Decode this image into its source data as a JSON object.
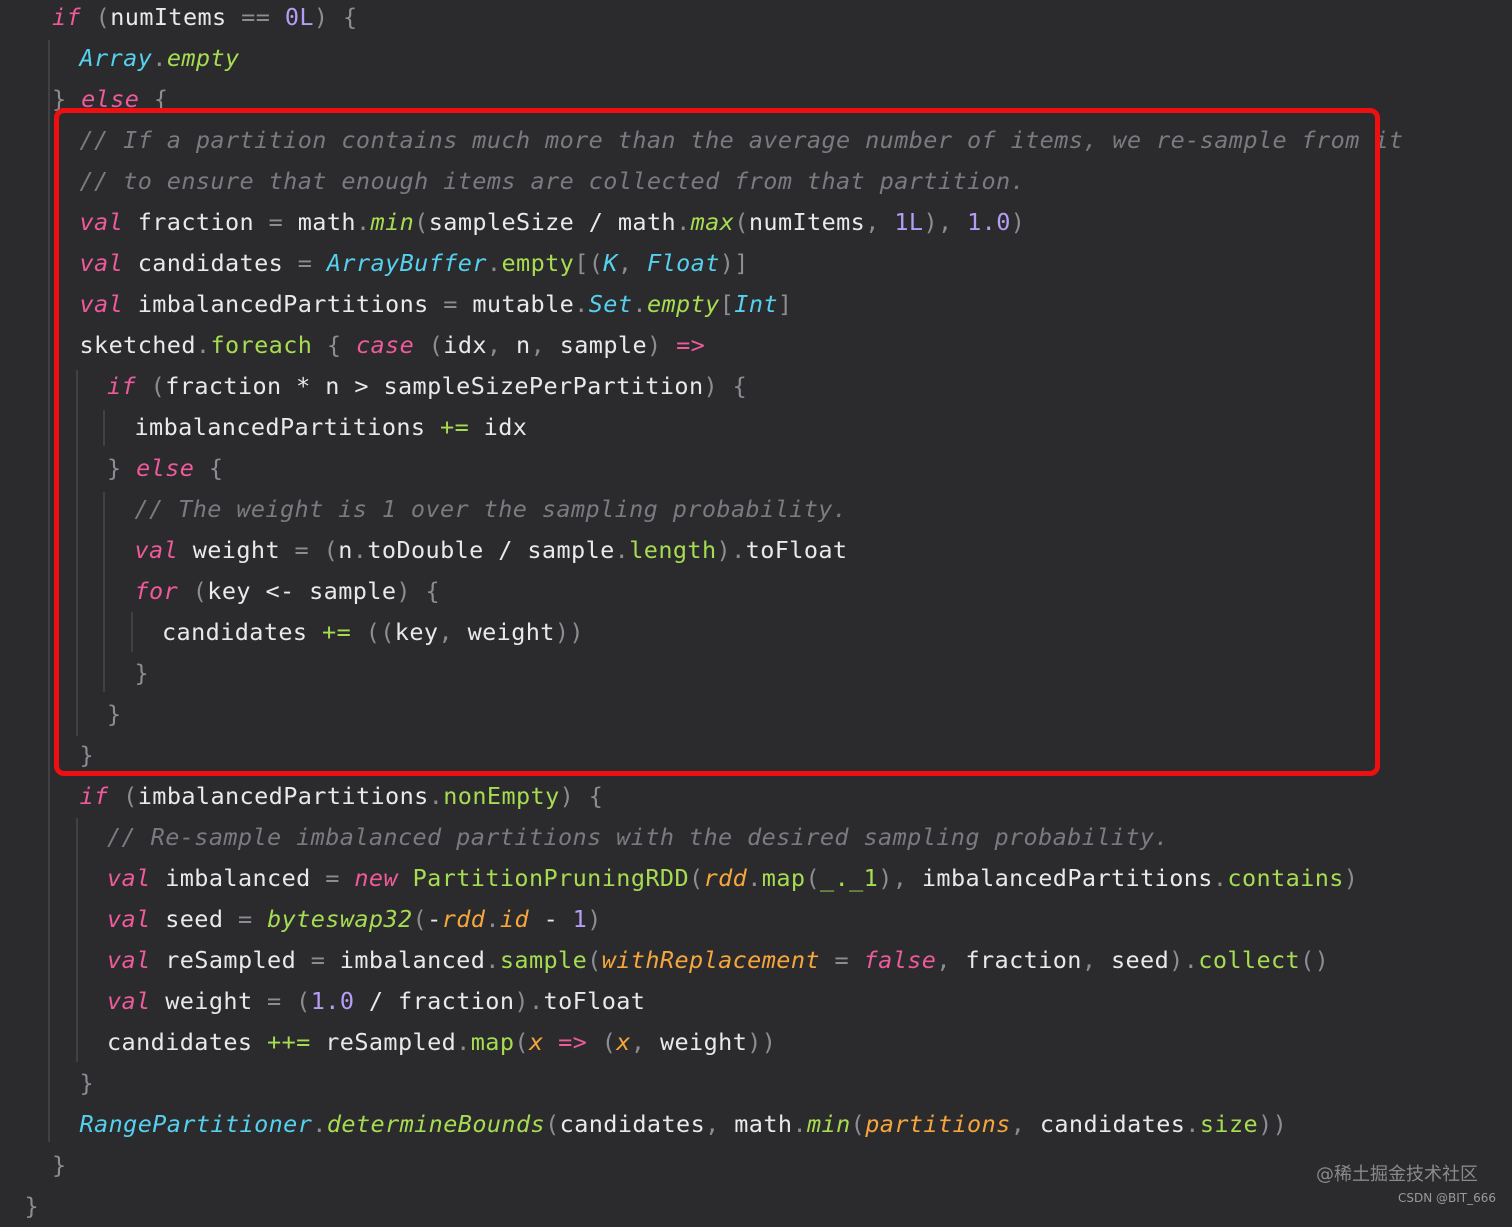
{
  "colors": {
    "background": "#2b2b2d",
    "plain": "#e9e9ec",
    "keyword": "#ee5a9b",
    "type": "#55d0ee",
    "method": "#a6dc52",
    "number": "#b49ef4",
    "punct": "#8c8c93",
    "comment": "#7a7a80",
    "param": "#f6a63c",
    "highlight_border": "#ee1010"
  },
  "code": {
    "lines": [
      {
        "indent": 0,
        "tokens": [
          [
            "if",
            "kw"
          ],
          [
            " (",
            "p"
          ],
          [
            "numItems",
            "n"
          ],
          [
            " == ",
            "p"
          ],
          [
            "0L",
            "num"
          ],
          [
            ") {",
            "p"
          ]
        ]
      },
      {
        "indent": 1,
        "tokens": [
          [
            "Array",
            "type"
          ],
          [
            ".",
            "p"
          ],
          [
            "empty",
            "fn"
          ]
        ]
      },
      {
        "indent": 0,
        "tokens": [
          [
            "} ",
            "p"
          ],
          [
            "else",
            "kw"
          ],
          [
            " {",
            "p"
          ]
        ]
      },
      {
        "indent": 1,
        "tokens": [
          [
            "// If a partition contains much more than the average number of items, we re-sample from it",
            "cm"
          ]
        ]
      },
      {
        "indent": 1,
        "tokens": [
          [
            "// to ensure that enough items are collected from that partition.",
            "cm"
          ]
        ]
      },
      {
        "indent": 1,
        "tokens": [
          [
            "val",
            "kw"
          ],
          [
            " fraction ",
            "n"
          ],
          [
            "=",
            "p"
          ],
          [
            " math",
            "n"
          ],
          [
            ".",
            "p"
          ],
          [
            "min",
            "fn"
          ],
          [
            "(",
            "p"
          ],
          [
            "sampleSize / math",
            "n"
          ],
          [
            ".",
            "p"
          ],
          [
            "max",
            "fn"
          ],
          [
            "(",
            "p"
          ],
          [
            "numItems",
            "n"
          ],
          [
            ", ",
            "p"
          ],
          [
            "1L",
            "num"
          ],
          [
            "), ",
            "p"
          ],
          [
            "1.0",
            "num"
          ],
          [
            ")",
            "p"
          ]
        ]
      },
      {
        "indent": 1,
        "tokens": [
          [
            "val",
            "kw"
          ],
          [
            " candidates ",
            "n"
          ],
          [
            "=",
            "p"
          ],
          [
            " ",
            "n"
          ],
          [
            "ArrayBuffer",
            "type"
          ],
          [
            ".",
            "p"
          ],
          [
            "empty",
            "meth"
          ],
          [
            "[(",
            "p"
          ],
          [
            "K",
            "type"
          ],
          [
            ", ",
            "p"
          ],
          [
            "Float",
            "type"
          ],
          [
            ")]",
            "p"
          ]
        ]
      },
      {
        "indent": 1,
        "tokens": [
          [
            "val",
            "kw"
          ],
          [
            " imbalancedPartitions ",
            "n"
          ],
          [
            "=",
            "p"
          ],
          [
            " mutable",
            "n"
          ],
          [
            ".",
            "p"
          ],
          [
            "Set",
            "type"
          ],
          [
            ".",
            "p"
          ],
          [
            "empty",
            "fn"
          ],
          [
            "[",
            "p"
          ],
          [
            "Int",
            "type"
          ],
          [
            "]",
            "p"
          ]
        ]
      },
      {
        "indent": 1,
        "tokens": [
          [
            "sketched",
            "n"
          ],
          [
            ".",
            "p"
          ],
          [
            "foreach",
            "meth"
          ],
          [
            " { ",
            "p"
          ],
          [
            "case",
            "kw"
          ],
          [
            " (",
            "p"
          ],
          [
            "idx",
            "n"
          ],
          [
            ", ",
            "p"
          ],
          [
            "n",
            "n"
          ],
          [
            ", ",
            "p"
          ],
          [
            "sample",
            "n"
          ],
          [
            ") ",
            "p"
          ],
          [
            "=>",
            "kw"
          ]
        ]
      },
      {
        "indent": 2,
        "tokens": [
          [
            "if",
            "kw"
          ],
          [
            " (",
            "p"
          ],
          [
            "fraction * n > sampleSizePerPartition",
            "n"
          ],
          [
            ") {",
            "p"
          ]
        ]
      },
      {
        "indent": 3,
        "tokens": [
          [
            "imbalancedPartitions ",
            "n"
          ],
          [
            "+=",
            "meth"
          ],
          [
            " idx",
            "n"
          ]
        ]
      },
      {
        "indent": 2,
        "tokens": [
          [
            "} ",
            "p"
          ],
          [
            "else",
            "kw"
          ],
          [
            " {",
            "p"
          ]
        ]
      },
      {
        "indent": 3,
        "tokens": [
          [
            "// The weight is 1 over the sampling probability.",
            "cm"
          ]
        ]
      },
      {
        "indent": 3,
        "tokens": [
          [
            "val",
            "kw"
          ],
          [
            " weight ",
            "n"
          ],
          [
            "=",
            "p"
          ],
          [
            " (",
            "p"
          ],
          [
            "n",
            "n"
          ],
          [
            ".",
            "p"
          ],
          [
            "toDouble / sample",
            "n"
          ],
          [
            ".",
            "p"
          ],
          [
            "length",
            "meth"
          ],
          [
            ").",
            "p"
          ],
          [
            "toFloat",
            "n"
          ]
        ]
      },
      {
        "indent": 3,
        "tokens": [
          [
            "for",
            "kw"
          ],
          [
            " (",
            "p"
          ],
          [
            "key <- sample",
            "n"
          ],
          [
            ") {",
            "p"
          ]
        ]
      },
      {
        "indent": 4,
        "tokens": [
          [
            "candidates ",
            "n"
          ],
          [
            "+=",
            "meth"
          ],
          [
            " ((",
            "p"
          ],
          [
            "key",
            "n"
          ],
          [
            ", ",
            "p"
          ],
          [
            "weight",
            "n"
          ],
          [
            "))",
            "p"
          ]
        ]
      },
      {
        "indent": 3,
        "tokens": [
          [
            "}",
            "p"
          ]
        ]
      },
      {
        "indent": 2,
        "tokens": [
          [
            "}",
            "p"
          ]
        ]
      },
      {
        "indent": 1,
        "tokens": [
          [
            "}",
            "p"
          ]
        ]
      },
      {
        "indent": 1,
        "tokens": [
          [
            "if",
            "kw"
          ],
          [
            " (",
            "p"
          ],
          [
            "imbalancedPartitions",
            "n"
          ],
          [
            ".",
            "p"
          ],
          [
            "nonEmpty",
            "meth"
          ],
          [
            ") {",
            "p"
          ]
        ]
      },
      {
        "indent": 2,
        "tokens": [
          [
            "// Re-sample imbalanced partitions with the desired sampling probability.",
            "cm"
          ]
        ]
      },
      {
        "indent": 2,
        "tokens": [
          [
            "val",
            "kw"
          ],
          [
            " imbalanced ",
            "n"
          ],
          [
            "=",
            "p"
          ],
          [
            " ",
            "n"
          ],
          [
            "new",
            "kw"
          ],
          [
            " ",
            "n"
          ],
          [
            "PartitionPruningRDD",
            "meth"
          ],
          [
            "(",
            "p"
          ],
          [
            "rdd",
            "param"
          ],
          [
            ".",
            "p"
          ],
          [
            "map",
            "meth"
          ],
          [
            "(",
            "p"
          ],
          [
            "_._1",
            "meth"
          ],
          [
            "), ",
            "p"
          ],
          [
            "imbalancedPartitions",
            "n"
          ],
          [
            ".",
            "p"
          ],
          [
            "contains",
            "meth"
          ],
          [
            ")",
            "p"
          ]
        ]
      },
      {
        "indent": 2,
        "tokens": [
          [
            "val",
            "kw"
          ],
          [
            " seed ",
            "n"
          ],
          [
            "=",
            "p"
          ],
          [
            " ",
            "n"
          ],
          [
            "byteswap32",
            "fn"
          ],
          [
            "(",
            "p"
          ],
          [
            "-",
            "n"
          ],
          [
            "rdd",
            "param"
          ],
          [
            ".",
            "p"
          ],
          [
            "id",
            "param"
          ],
          [
            " - ",
            "n"
          ],
          [
            "1",
            "num"
          ],
          [
            ")",
            "p"
          ]
        ]
      },
      {
        "indent": 2,
        "tokens": [
          [
            "val",
            "kw"
          ],
          [
            " reSampled ",
            "n"
          ],
          [
            "=",
            "p"
          ],
          [
            " imbalanced",
            "n"
          ],
          [
            ".",
            "p"
          ],
          [
            "sample",
            "meth"
          ],
          [
            "(",
            "p"
          ],
          [
            "withReplacement",
            "param"
          ],
          [
            " = ",
            "p"
          ],
          [
            "false",
            "kw"
          ],
          [
            ", ",
            "p"
          ],
          [
            "fraction",
            "n"
          ],
          [
            ", ",
            "p"
          ],
          [
            "seed",
            "n"
          ],
          [
            ").",
            "p"
          ],
          [
            "collect",
            "meth"
          ],
          [
            "()",
            "p"
          ]
        ]
      },
      {
        "indent": 2,
        "tokens": [
          [
            "val",
            "kw"
          ],
          [
            " weight ",
            "n"
          ],
          [
            "=",
            "p"
          ],
          [
            " (",
            "p"
          ],
          [
            "1.0",
            "num"
          ],
          [
            " / fraction",
            "n"
          ],
          [
            ").",
            "p"
          ],
          [
            "toFloat",
            "n"
          ]
        ]
      },
      {
        "indent": 2,
        "tokens": [
          [
            "candidates ",
            "n"
          ],
          [
            "++=",
            "meth"
          ],
          [
            " reSampled",
            "n"
          ],
          [
            ".",
            "p"
          ],
          [
            "map",
            "meth"
          ],
          [
            "(",
            "p"
          ],
          [
            "x",
            "param"
          ],
          [
            " => ",
            "kw"
          ],
          [
            "(",
            "p"
          ],
          [
            "x",
            "param"
          ],
          [
            ", ",
            "p"
          ],
          [
            "weight",
            "n"
          ],
          [
            "))",
            "p"
          ]
        ]
      },
      {
        "indent": 1,
        "tokens": [
          [
            "}",
            "p"
          ]
        ]
      },
      {
        "indent": 1,
        "tokens": [
          [
            "RangePartitioner",
            "type"
          ],
          [
            ".",
            "p"
          ],
          [
            "determineBounds",
            "fn"
          ],
          [
            "(",
            "p"
          ],
          [
            "candidates",
            "n"
          ],
          [
            ", ",
            "p"
          ],
          [
            "math",
            "n"
          ],
          [
            ".",
            "p"
          ],
          [
            "min",
            "fn"
          ],
          [
            "(",
            "p"
          ],
          [
            "partitions",
            "param"
          ],
          [
            ", ",
            "p"
          ],
          [
            "candidates",
            "n"
          ],
          [
            ".",
            "p"
          ],
          [
            "size",
            "meth"
          ],
          [
            "))",
            "p"
          ]
        ]
      },
      {
        "indent": 0,
        "tokens": [
          [
            "}",
            "p"
          ]
        ]
      },
      {
        "indent": -1,
        "tokens": [
          [
            "}",
            "p"
          ]
        ]
      }
    ]
  },
  "watermark": {
    "juejin": "@稀土掘金技术社区",
    "csdn": "CSDN @BIT_666"
  }
}
